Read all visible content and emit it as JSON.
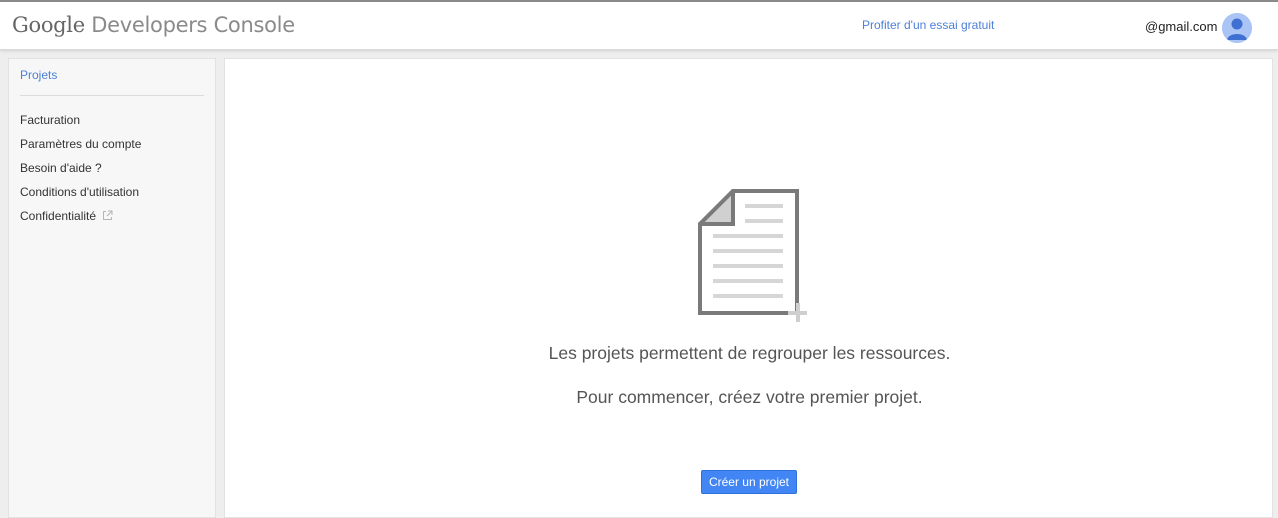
{
  "header": {
    "logo_brand": "Google",
    "logo_product": "Developers Console",
    "trial_link": "Profiter d'un essai gratuit",
    "account_email": "@gmail.com"
  },
  "sidebar": {
    "active_item": "Projets",
    "items": [
      {
        "label": "Facturation"
      },
      {
        "label": "Paramètres du compte"
      },
      {
        "label": "Besoin d'aide ?"
      },
      {
        "label": "Conditions d'utilisation"
      },
      {
        "label": "Confidentialité",
        "icon": "external-link-icon"
      }
    ]
  },
  "main": {
    "empty_icon": "new-document-icon",
    "message_1": "Les projets permettent de regrouper les ressources.",
    "message_2": "Pour commencer, créez votre premier projet.",
    "create_button": "Créer un projet"
  },
  "colors": {
    "accent": "#4285f4",
    "link": "#4d80d6",
    "background": "#eeeeee"
  }
}
